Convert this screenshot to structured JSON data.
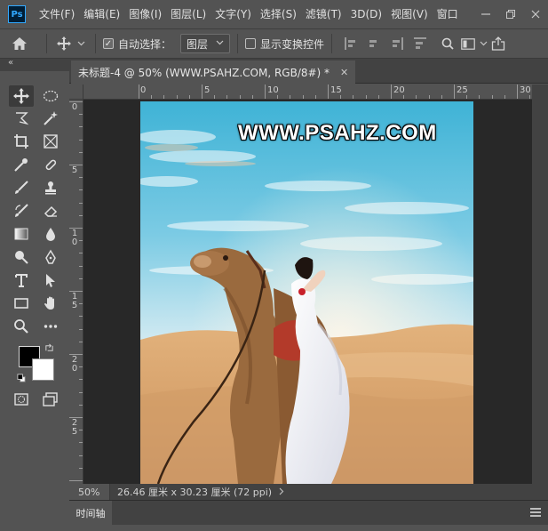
{
  "app": {
    "logo": "Ps"
  },
  "menu": [
    "文件(F)",
    "编辑(E)",
    "图像(I)",
    "图层(L)",
    "文字(Y)",
    "选择(S)",
    "滤镜(T)",
    "3D(D)",
    "视图(V)",
    "窗口"
  ],
  "window_controls": [
    "minimize-icon",
    "restore-icon",
    "close-icon"
  ],
  "options": {
    "auto_select_label": "自动选择：",
    "auto_select_checked": true,
    "auto_select_target": "图层",
    "show_transform_label": "显示变换控件",
    "show_transform_checked": false
  },
  "tools_panel": {
    "collapse_glyph": "«"
  },
  "document": {
    "tab_title": "未标题-4 @ 50% (WWW.PSAHZ.COM, RGB/8#) *",
    "watermark": "WWW.PSAHZ.COM"
  },
  "rulers": {
    "top_labels": [
      "0",
      "5",
      "10",
      "15",
      "20",
      "25",
      "30"
    ],
    "left_labels": [
      "0",
      "5",
      "1 0",
      "1 5",
      "2 0",
      "2 5"
    ]
  },
  "status": {
    "zoom": "50%",
    "dimensions": "26.46 厘米 x 30.23 厘米 (72 ppi)"
  },
  "timeline": {
    "tab_label": "时间轴"
  },
  "colors": {
    "foreground": "#000000",
    "background": "#ffffff",
    "ui_bg": "#535353",
    "ui_dark": "#424242",
    "pasteboard": "#282828"
  }
}
